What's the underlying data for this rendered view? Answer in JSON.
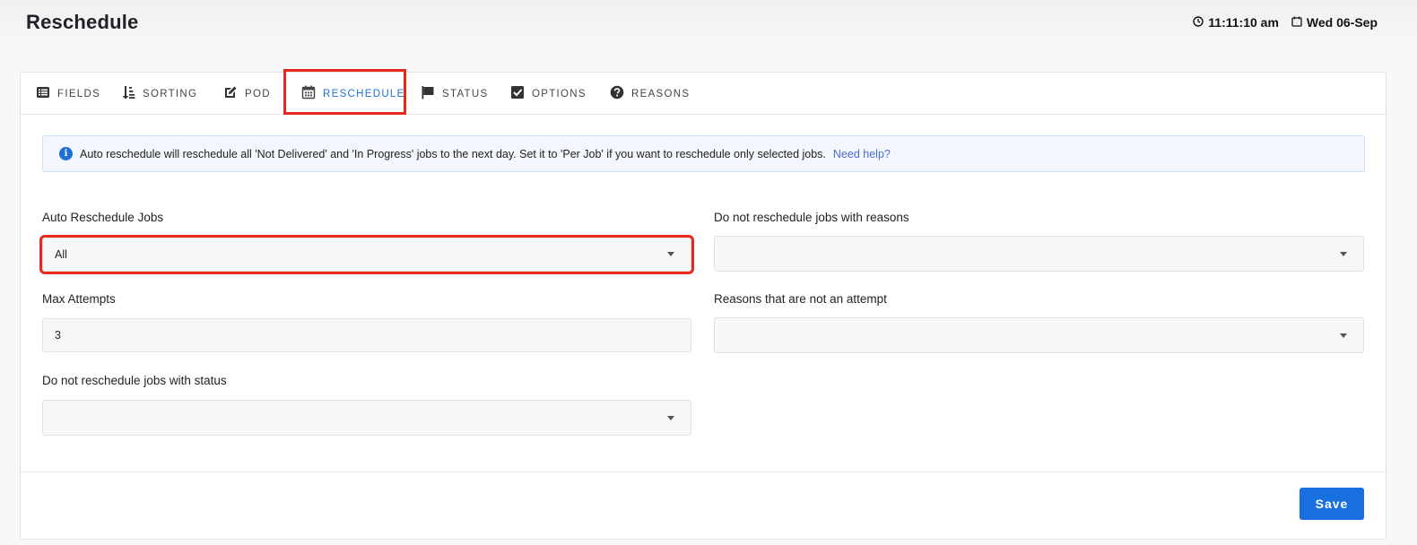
{
  "header": {
    "title": "Reschedule",
    "time": "11:11:10 am",
    "date": "Wed 06-Sep"
  },
  "tabs": [
    {
      "label": "FIELDS",
      "icon": "list-icon"
    },
    {
      "label": "SORTING",
      "icon": "sort-icon"
    },
    {
      "label": "POD",
      "icon": "edit-icon"
    },
    {
      "label": "RESCHEDULE",
      "icon": "calendar-icon",
      "active": true
    },
    {
      "label": "STATUS",
      "icon": "flag-icon"
    },
    {
      "label": "OPTIONS",
      "icon": "checkbox-icon"
    },
    {
      "label": "REASONS",
      "icon": "question-circle-icon"
    }
  ],
  "info": {
    "text": "Auto reschedule will reschedule all 'Not Delivered' and 'In Progress' jobs to the next day. Set it to 'Per Job' if you want to reschedule only selected jobs.",
    "link": "Need help?"
  },
  "form": {
    "auto_reschedule": {
      "label": "Auto Reschedule Jobs",
      "value": "All"
    },
    "max_attempts": {
      "label": "Max Attempts",
      "value": "3"
    },
    "status_exclude": {
      "label": "Do not reschedule jobs with status",
      "value": ""
    },
    "reasons_exclude": {
      "label": "Do not reschedule jobs with reasons",
      "value": ""
    },
    "not_attempt_reasons": {
      "label": "Reasons that are not an attempt",
      "value": ""
    }
  },
  "footer": {
    "save_label": "Save"
  },
  "colors": {
    "accent": "#1a6fe0",
    "highlight": "#e8281f"
  }
}
